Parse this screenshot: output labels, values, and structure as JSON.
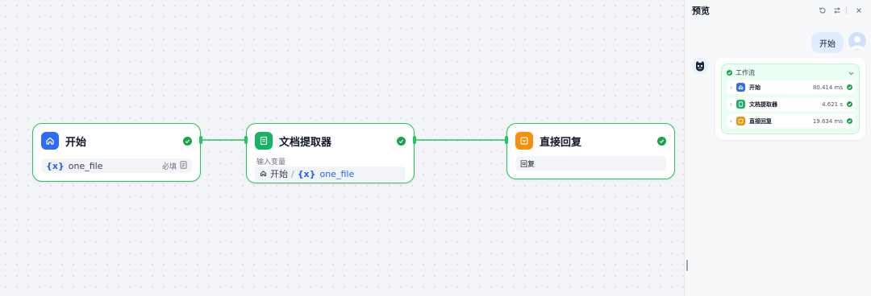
{
  "workflow": {
    "nodes": [
      {
        "title": "开始",
        "var_icon": "{x}",
        "var_name": "one_file",
        "required": "必填",
        "icon": "home-icon",
        "color": "#2f6bf5"
      },
      {
        "title": "文档提取器",
        "input_label": "输入变量",
        "source": "开始",
        "separator": "/",
        "var_icon": "{x}",
        "var_name": "one_file",
        "icon": "document-icon",
        "color": "#16b364"
      },
      {
        "title": "直接回复",
        "field": "回复",
        "icon": "reply-icon",
        "color": "#f79009"
      }
    ],
    "status_color": "#16a34a"
  },
  "preview": {
    "title": "预览",
    "user_message": "开始",
    "workflow_label": "工作流",
    "runs": [
      {
        "name": "开始",
        "time": "80.414 ms",
        "color": "#2f6bf5"
      },
      {
        "name": "文档提取器",
        "time": "4.621 s",
        "color": "#16b364"
      },
      {
        "name": "直接回复",
        "time": "19.634 ms",
        "color": "#f79009"
      }
    ]
  }
}
